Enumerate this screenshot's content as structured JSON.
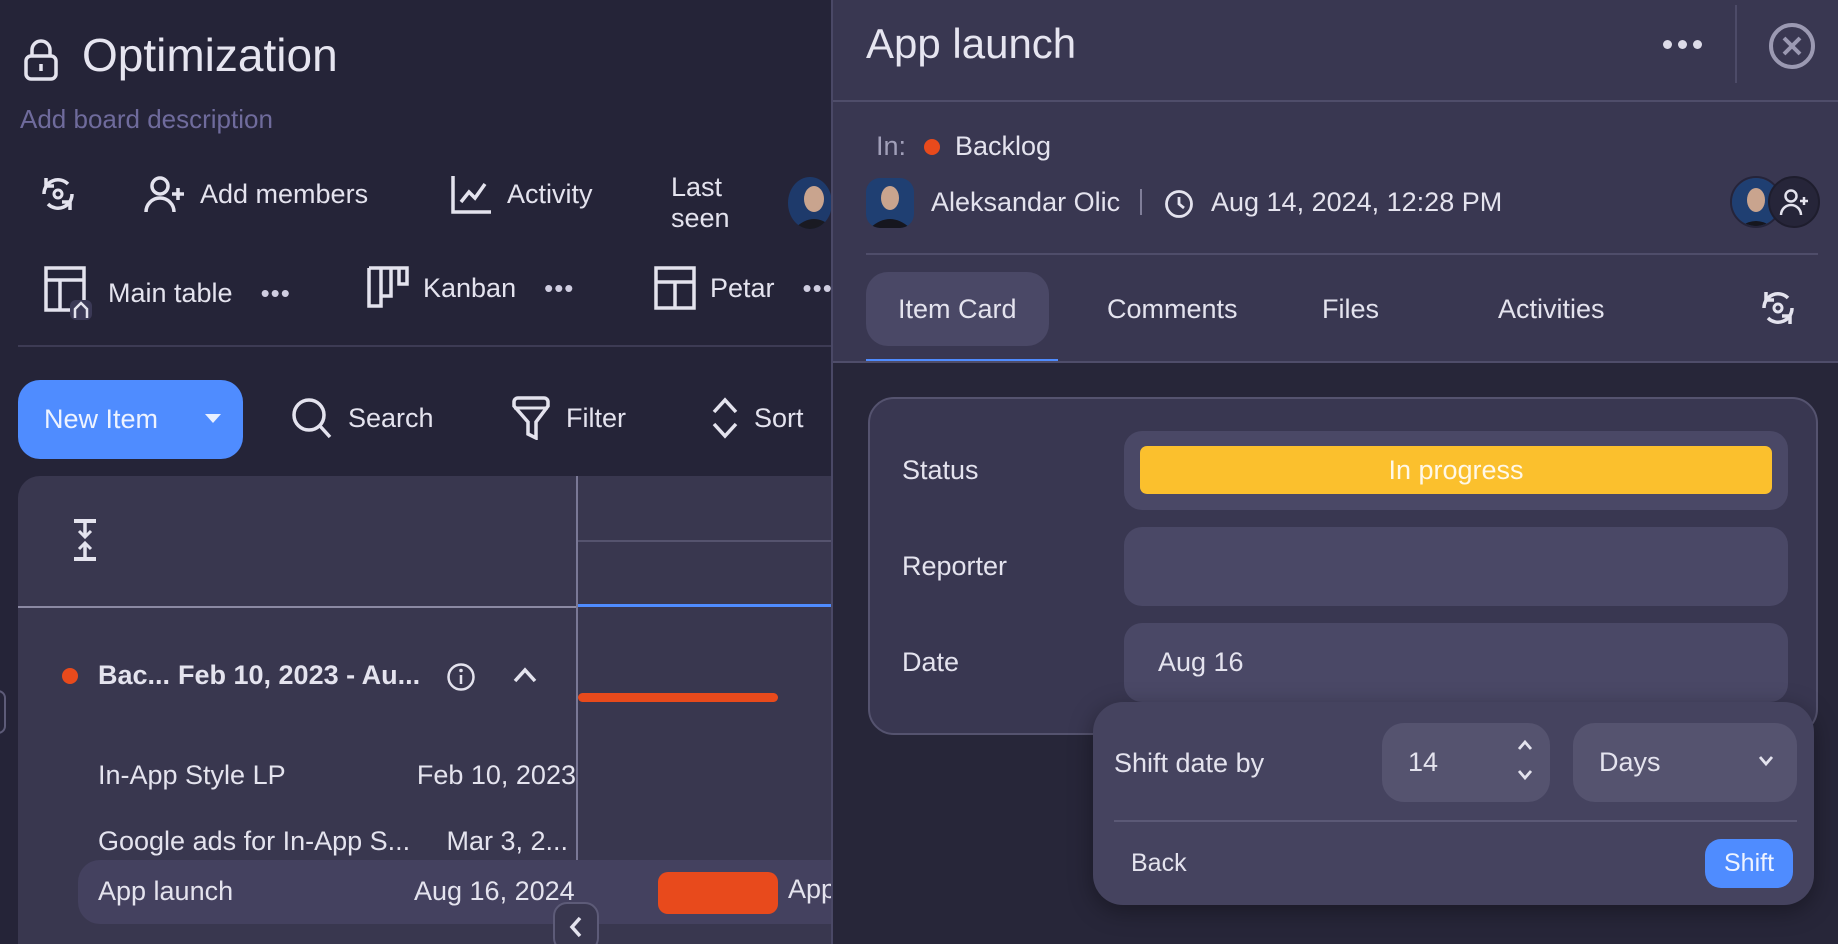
{
  "board": {
    "title": "Optimization",
    "description_placeholder": "Add board description",
    "toolbar": {
      "add_members": "Add members",
      "activity": "Activity",
      "last_seen": "Last seen"
    },
    "views": [
      {
        "label": "Main table",
        "more": "•••"
      },
      {
        "label": "Kanban",
        "more": "•••"
      },
      {
        "label": "Petar",
        "more": "•••"
      }
    ],
    "actions": {
      "new_item": "New Item",
      "search": "Search",
      "filter": "Filter",
      "sort": "Sort"
    },
    "gantt": {
      "group": {
        "name": "Bac...",
        "range": "Feb 10, 2023 - Au...",
        "color": "#e84a1c"
      },
      "items": [
        {
          "name": "In-App Style LP",
          "date": "Feb 10, 2023"
        },
        {
          "name": "Google ads for In-App S...",
          "date": "Mar 3, 2..."
        },
        {
          "name": "App launch",
          "date": "Aug 16, 2024",
          "selected": true
        }
      ],
      "bar_label": "App launch"
    }
  },
  "panel": {
    "title": "App launch",
    "in_label": "In:",
    "group": "Backlog",
    "group_color": "#e84a1c",
    "author": "Aleksandar Olic",
    "created_at": "Aug 14, 2024, 12:28 PM",
    "tabs": [
      {
        "label": "Item Card",
        "active": true
      },
      {
        "label": "Comments"
      },
      {
        "label": "Files"
      },
      {
        "label": "Activities"
      }
    ],
    "fields": {
      "status_label": "Status",
      "status_value": "In progress",
      "status_color": "#fbc02d",
      "reporter_label": "Reporter",
      "reporter_value": "",
      "date_label": "Date",
      "date_value": "Aug 16"
    },
    "shift_popover": {
      "label": "Shift date by",
      "amount": "14",
      "unit": "Days",
      "back": "Back",
      "shift": "Shift"
    }
  },
  "colors": {
    "accent": "#4f8cff",
    "background": "#252438",
    "panel": "#393751"
  }
}
